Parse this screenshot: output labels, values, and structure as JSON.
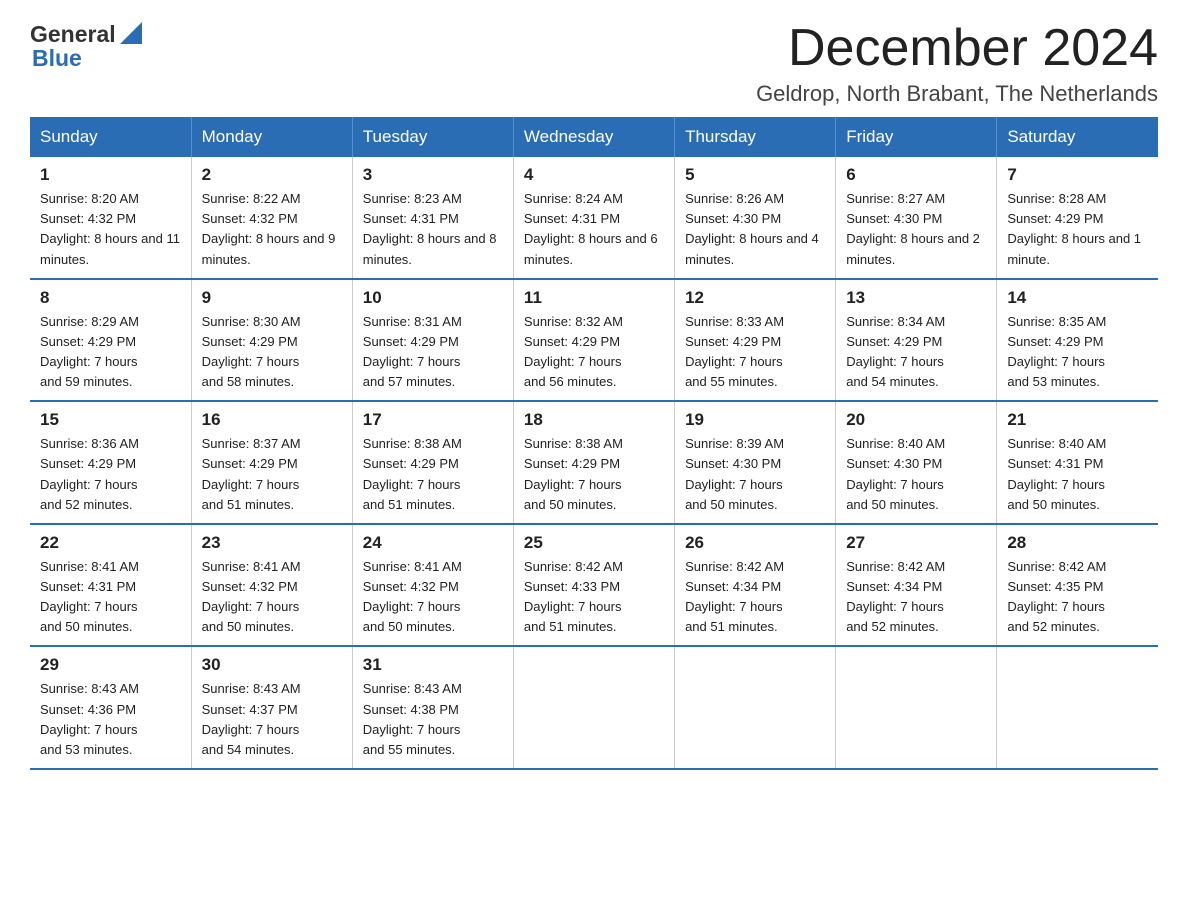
{
  "header": {
    "month_title": "December 2024",
    "location": "Geldrop, North Brabant, The Netherlands",
    "logo_general": "General",
    "logo_blue": "Blue"
  },
  "weekdays": [
    "Sunday",
    "Monday",
    "Tuesday",
    "Wednesday",
    "Thursday",
    "Friday",
    "Saturday"
  ],
  "weeks": [
    [
      {
        "day": "1",
        "sunrise": "8:20 AM",
        "sunset": "4:32 PM",
        "daylight": "8 hours and 11 minutes."
      },
      {
        "day": "2",
        "sunrise": "8:22 AM",
        "sunset": "4:32 PM",
        "daylight": "8 hours and 9 minutes."
      },
      {
        "day": "3",
        "sunrise": "8:23 AM",
        "sunset": "4:31 PM",
        "daylight": "8 hours and 8 minutes."
      },
      {
        "day": "4",
        "sunrise": "8:24 AM",
        "sunset": "4:31 PM",
        "daylight": "8 hours and 6 minutes."
      },
      {
        "day": "5",
        "sunrise": "8:26 AM",
        "sunset": "4:30 PM",
        "daylight": "8 hours and 4 minutes."
      },
      {
        "day": "6",
        "sunrise": "8:27 AM",
        "sunset": "4:30 PM",
        "daylight": "8 hours and 2 minutes."
      },
      {
        "day": "7",
        "sunrise": "8:28 AM",
        "sunset": "4:29 PM",
        "daylight": "8 hours and 1 minute."
      }
    ],
    [
      {
        "day": "8",
        "sunrise": "8:29 AM",
        "sunset": "4:29 PM",
        "daylight": "7 hours and 59 minutes."
      },
      {
        "day": "9",
        "sunrise": "8:30 AM",
        "sunset": "4:29 PM",
        "daylight": "7 hours and 58 minutes."
      },
      {
        "day": "10",
        "sunrise": "8:31 AM",
        "sunset": "4:29 PM",
        "daylight": "7 hours and 57 minutes."
      },
      {
        "day": "11",
        "sunrise": "8:32 AM",
        "sunset": "4:29 PM",
        "daylight": "7 hours and 56 minutes."
      },
      {
        "day": "12",
        "sunrise": "8:33 AM",
        "sunset": "4:29 PM",
        "daylight": "7 hours and 55 minutes."
      },
      {
        "day": "13",
        "sunrise": "8:34 AM",
        "sunset": "4:29 PM",
        "daylight": "7 hours and 54 minutes."
      },
      {
        "day": "14",
        "sunrise": "8:35 AM",
        "sunset": "4:29 PM",
        "daylight": "7 hours and 53 minutes."
      }
    ],
    [
      {
        "day": "15",
        "sunrise": "8:36 AM",
        "sunset": "4:29 PM",
        "daylight": "7 hours and 52 minutes."
      },
      {
        "day": "16",
        "sunrise": "8:37 AM",
        "sunset": "4:29 PM",
        "daylight": "7 hours and 51 minutes."
      },
      {
        "day": "17",
        "sunrise": "8:38 AM",
        "sunset": "4:29 PM",
        "daylight": "7 hours and 51 minutes."
      },
      {
        "day": "18",
        "sunrise": "8:38 AM",
        "sunset": "4:29 PM",
        "daylight": "7 hours and 50 minutes."
      },
      {
        "day": "19",
        "sunrise": "8:39 AM",
        "sunset": "4:30 PM",
        "daylight": "7 hours and 50 minutes."
      },
      {
        "day": "20",
        "sunrise": "8:40 AM",
        "sunset": "4:30 PM",
        "daylight": "7 hours and 50 minutes."
      },
      {
        "day": "21",
        "sunrise": "8:40 AM",
        "sunset": "4:31 PM",
        "daylight": "7 hours and 50 minutes."
      }
    ],
    [
      {
        "day": "22",
        "sunrise": "8:41 AM",
        "sunset": "4:31 PM",
        "daylight": "7 hours and 50 minutes."
      },
      {
        "day": "23",
        "sunrise": "8:41 AM",
        "sunset": "4:32 PM",
        "daylight": "7 hours and 50 minutes."
      },
      {
        "day": "24",
        "sunrise": "8:41 AM",
        "sunset": "4:32 PM",
        "daylight": "7 hours and 50 minutes."
      },
      {
        "day": "25",
        "sunrise": "8:42 AM",
        "sunset": "4:33 PM",
        "daylight": "7 hours and 51 minutes."
      },
      {
        "day": "26",
        "sunrise": "8:42 AM",
        "sunset": "4:34 PM",
        "daylight": "7 hours and 51 minutes."
      },
      {
        "day": "27",
        "sunrise": "8:42 AM",
        "sunset": "4:34 PM",
        "daylight": "7 hours and 52 minutes."
      },
      {
        "day": "28",
        "sunrise": "8:42 AM",
        "sunset": "4:35 PM",
        "daylight": "7 hours and 52 minutes."
      }
    ],
    [
      {
        "day": "29",
        "sunrise": "8:43 AM",
        "sunset": "4:36 PM",
        "daylight": "7 hours and 53 minutes."
      },
      {
        "day": "30",
        "sunrise": "8:43 AM",
        "sunset": "4:37 PM",
        "daylight": "7 hours and 54 minutes."
      },
      {
        "day": "31",
        "sunrise": "8:43 AM",
        "sunset": "4:38 PM",
        "daylight": "7 hours and 55 minutes."
      },
      null,
      null,
      null,
      null
    ]
  ],
  "labels": {
    "sunrise": "Sunrise:",
    "sunset": "Sunset:",
    "daylight": "Daylight:"
  }
}
